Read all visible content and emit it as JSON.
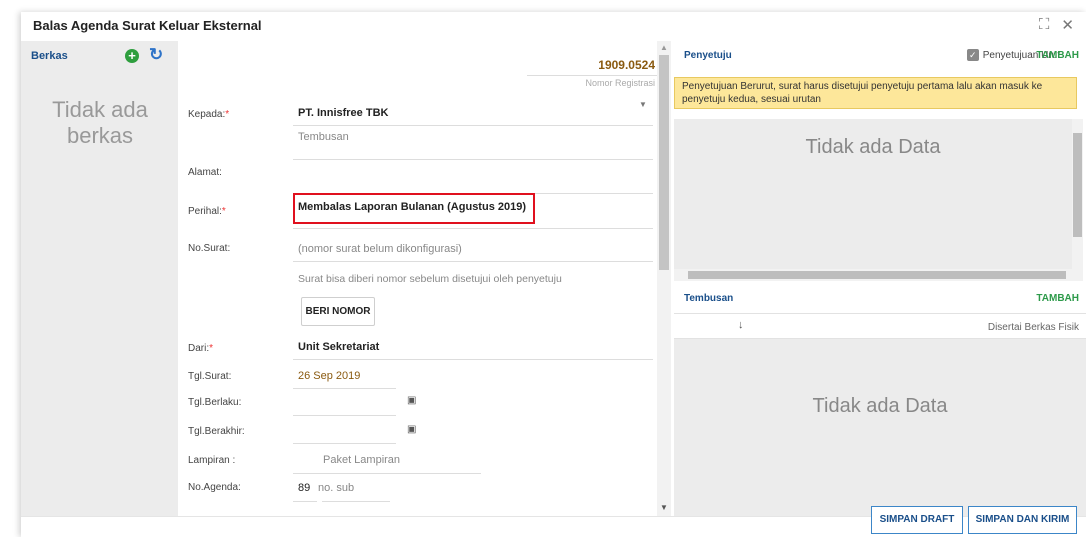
{
  "dialog": {
    "title": "Balas Agenda Surat Keluar Eksternal"
  },
  "berkas": {
    "header": "Berkas",
    "empty_text": "Tidak ada berkas"
  },
  "form": {
    "reg_number": "1909.0524",
    "reg_label": "Nomor Registrasi",
    "kepada_label": "Kepada:",
    "kepada_value": "PT. Innisfree TBK",
    "tembusan_placeholder": "Tembusan",
    "alamat_label": "Alamat:",
    "perihal_label": "Perihal:",
    "perihal_value": "Membalas Laporan Bulanan (Agustus 2019)",
    "nosurat_label": "No.Surat:",
    "nosurat_value": "(nomor surat belum dikonfigurasi)",
    "nosurat_hint": "Surat bisa diberi nomor sebelum disetujui oleh penyetuju",
    "beri_nomor": "BERI NOMOR",
    "dari_label": "Dari:",
    "dari_value": "Unit Sekretariat",
    "tgl_surat_label": "Tgl.Surat:",
    "tgl_surat_value": "26 Sep 2019",
    "tgl_berlaku_label": "Tgl.Berlaku:",
    "tgl_berakhir_label": "Tgl.Berakhir:",
    "lampiran_label": "Lampiran :",
    "lampiran_placeholder": "Paket Lampiran",
    "noagenda_label": "No.Agenda:",
    "noagenda_value": "89",
    "nosub_placeholder": "no. sub",
    "required_mark": "*"
  },
  "penyetuju": {
    "header": "Penyetuju",
    "urut_label": "Penyetujuan Urut",
    "urut_checked": true,
    "tambah": "TAMBAH",
    "notice": "Penyetujuan Berurut, surat harus disetujui penyetuju pertama lalu akan masuk ke penyetuju kedua, sesuai urutan",
    "empty_text": "Tidak ada Data"
  },
  "tembusan": {
    "header": "Tembusan",
    "tambah": "TAMBAH",
    "disertai": "Disertai Berkas Fisik",
    "empty_text": "Tidak ada Data"
  },
  "footer": {
    "draft": "SIMPAN DRAFT",
    "kirim": "SIMPAN DAN KIRIM"
  },
  "colors": {
    "accent": "#1a4f8a",
    "tambah": "#2d9a4a",
    "highlight_box": "#e0101e",
    "notice_bg": "#fde79a"
  },
  "icons": {
    "add": "plus-circle-icon",
    "refresh": "refresh-icon",
    "expand": "expand-icon",
    "close": "close-icon",
    "calendar": "calendar-icon",
    "checkbox": "checkbox-icon",
    "sort": "arrow-down-icon"
  }
}
